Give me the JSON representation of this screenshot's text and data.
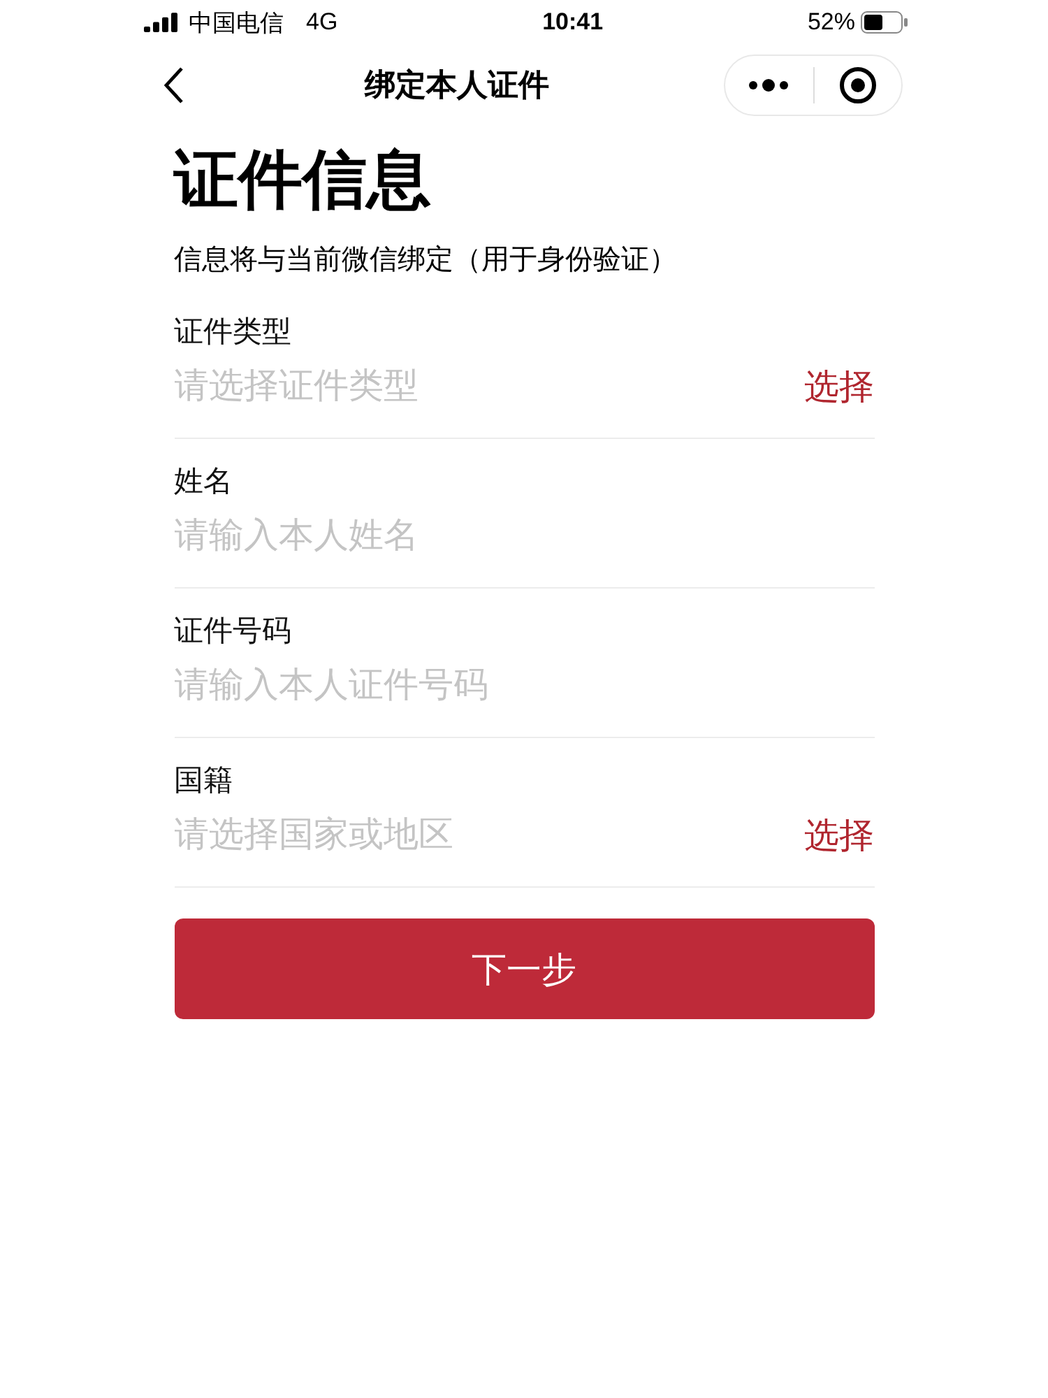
{
  "status_bar": {
    "carrier": "中国电信",
    "network": "4G",
    "time": "10:41",
    "battery": "52%"
  },
  "nav": {
    "title": "绑定本人证件"
  },
  "heading": "证件信息",
  "subtitle": "信息将与当前微信绑定（用于身份验证）",
  "fields": [
    {
      "kind": "select",
      "label": "证件类型",
      "placeholder": "请选择证件类型",
      "action": "选择"
    },
    {
      "kind": "input",
      "label": "姓名",
      "placeholder": "请输入本人姓名"
    },
    {
      "kind": "input",
      "label": "证件号码",
      "placeholder": "请输入本人证件号码"
    },
    {
      "kind": "select",
      "label": "国籍",
      "placeholder": "请选择国家或地区",
      "action": "选择"
    }
  ],
  "submit": "下一步"
}
